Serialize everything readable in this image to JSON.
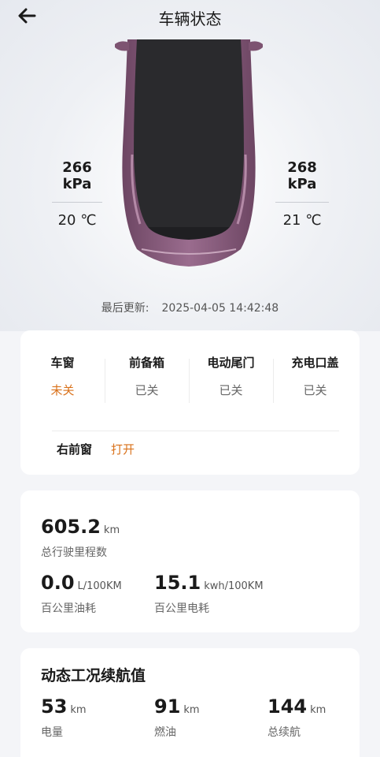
{
  "header": {
    "title": "车辆状态"
  },
  "tires": {
    "left": {
      "pressure": "266 kPa",
      "temperature": "20 ℃"
    },
    "right": {
      "pressure": "268 kPa",
      "temperature": "21 ℃"
    }
  },
  "update": {
    "label": "最后更新:",
    "timestamp": "2025-04-05 14:42:48"
  },
  "status": {
    "items": [
      {
        "label": "车窗",
        "value": "未关"
      },
      {
        "label": "前备箱",
        "value": "已关"
      },
      {
        "label": "电动尾门",
        "value": "已关"
      },
      {
        "label": "充电口盖",
        "value": "已关"
      }
    ],
    "open_item": {
      "label": "右前窗",
      "value": "打开"
    }
  },
  "mileage": {
    "total": {
      "value": "605.2",
      "unit": "km",
      "label": "总行驶里程数"
    },
    "fuel": {
      "value": "0.0",
      "unit": "L/100KM",
      "label": "百公里油耗"
    },
    "electric": {
      "value": "15.1",
      "unit": "kwh/100KM",
      "label": "百公里电耗"
    }
  },
  "range": {
    "title": "动态工况续航值",
    "battery": {
      "value": "53",
      "unit": "km",
      "label": "电量"
    },
    "fuel": {
      "value": "91",
      "unit": "km",
      "label": "燃油"
    },
    "total": {
      "value": "144",
      "unit": "km",
      "label": "总续航"
    }
  },
  "colors": {
    "accent": "#d9711a",
    "car_body": "#8a5c7e",
    "background": "#f4f5f8"
  }
}
